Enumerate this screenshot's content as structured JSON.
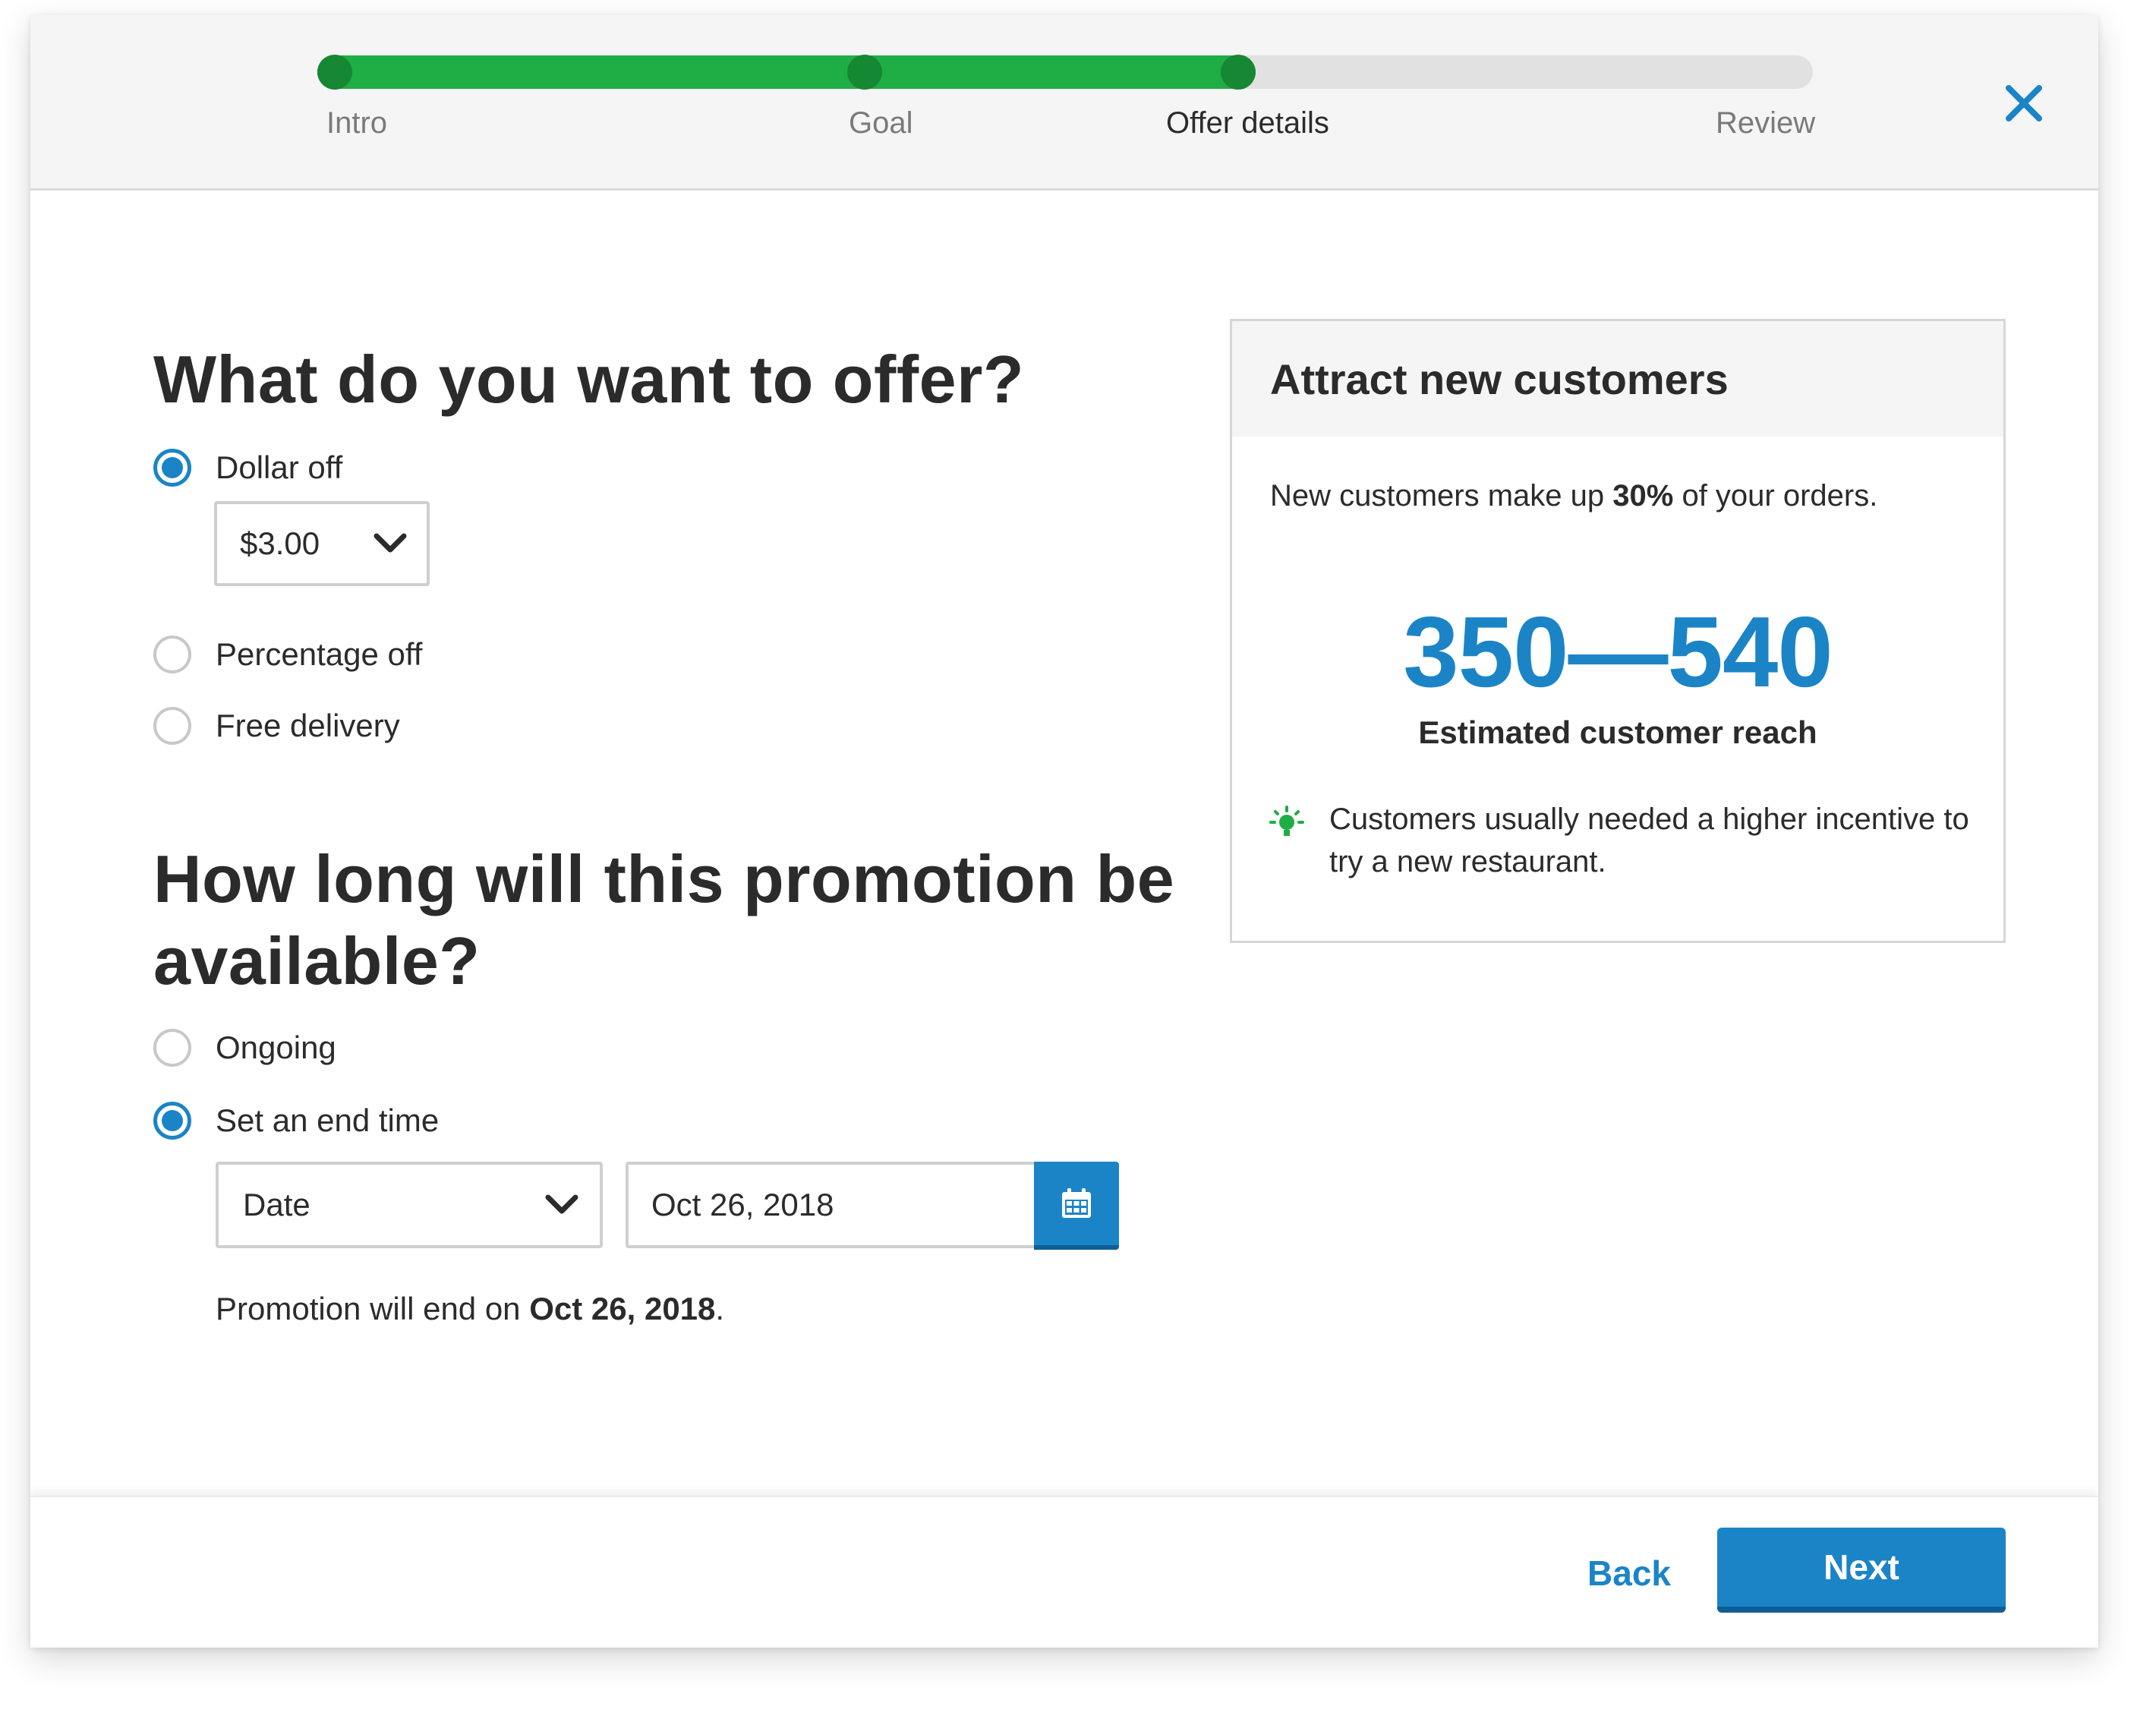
{
  "stepper": {
    "steps": [
      {
        "label": "Intro"
      },
      {
        "label": "Goal"
      },
      {
        "label": "Offer details"
      },
      {
        "label": "Review"
      }
    ],
    "current_step": 3,
    "progress": 0.62,
    "close_icon": "close-icon"
  },
  "offer": {
    "heading": "What do you want to offer?",
    "options": [
      {
        "label": "Dollar off",
        "checked": true
      },
      {
        "label": "Percentage off",
        "checked": false
      },
      {
        "label": "Free delivery",
        "checked": false
      }
    ],
    "amount_select": {
      "value": "$3.00",
      "icon": "chevron-down-icon"
    }
  },
  "duration": {
    "heading_line1": "How long will this promotion be",
    "heading_line2": "available?",
    "options": [
      {
        "label": "Ongoing",
        "checked": false
      },
      {
        "label": "Set an end time",
        "checked": true
      }
    ],
    "end_type_select": {
      "value": "Date",
      "icon": "chevron-down-icon"
    },
    "date_value": "Oct 26, 2018",
    "calendar_icon": "calendar-icon",
    "note_prefix": "Promotion will end on ",
    "note_date": "Oct 26, 2018",
    "note_suffix": "."
  },
  "card": {
    "title": "Attract new customers",
    "text_prefix": "New customers make up ",
    "text_bold": "30%",
    "text_suffix": " of your orders.",
    "reach_value": "350—540",
    "reach_label": "Estimated customer reach",
    "tip_icon": "lightbulb-icon",
    "tip": "Customers usually needed a higher incentive to try a new restaurant."
  },
  "footer": {
    "back_label": "Back",
    "next_label": "Next"
  },
  "colors": {
    "accent": "#1b84c7",
    "progress_green": "#1fad45",
    "progress_dot": "#168732",
    "tip_green": "#1fad45"
  }
}
